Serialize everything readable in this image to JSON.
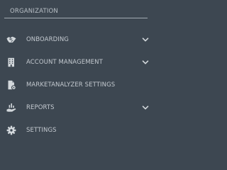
{
  "sidebar": {
    "section_title": "ORGANIZATION",
    "items": [
      {
        "label": "ONBOARDING",
        "icon": "handshake-icon",
        "has_chevron": true
      },
      {
        "label": "ACCOUNT MANAGEMENT",
        "icon": "building-icon",
        "has_chevron": true
      },
      {
        "label": "MARKETANALYZER SETTINGS",
        "icon": "file-settings-icon",
        "has_chevron": false
      },
      {
        "label": "REPORTS",
        "icon": "hand-chart-icon",
        "has_chevron": true
      },
      {
        "label": "SETTINGS",
        "icon": "gear-icon",
        "has_chevron": false
      }
    ]
  },
  "colors": {
    "background": "#3d4751",
    "text": "#c4cad0",
    "header_text": "#b9c0c6",
    "icon": "#d3d8dc",
    "divider": "#a3abb2"
  }
}
